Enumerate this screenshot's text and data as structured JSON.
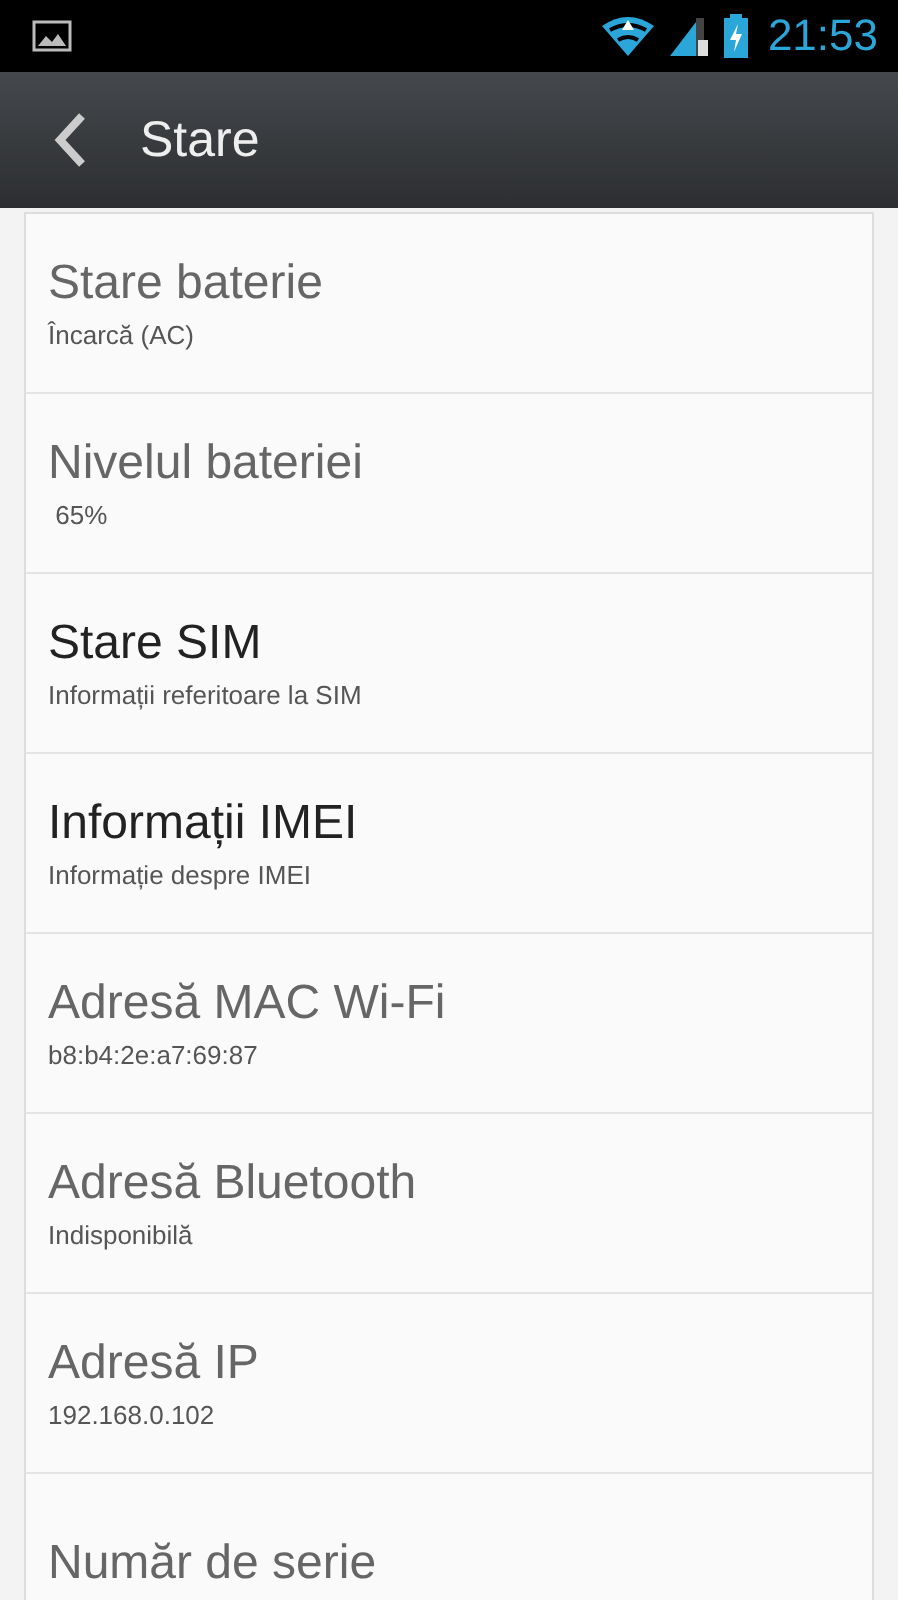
{
  "status_bar": {
    "time": "21:53"
  },
  "action_bar": {
    "title": "Stare"
  },
  "items": [
    {
      "title": "Stare baterie",
      "summary": "Încarcă (AC)",
      "disabled": true
    },
    {
      "title": "Nivelul bateriei",
      "summary": " 65%",
      "disabled": true
    },
    {
      "title": "Stare SIM",
      "summary": "Informații referitoare la SIM",
      "disabled": false
    },
    {
      "title": "Informații IMEI",
      "summary": "Informație despre IMEI",
      "disabled": false
    },
    {
      "title": "Adresă MAC Wi-Fi",
      "summary": "b8:b4:2e:a7:69:87",
      "disabled": true
    },
    {
      "title": "Adresă Bluetooth",
      "summary": "Indisponibilă",
      "disabled": true
    },
    {
      "title": "Adresă IP",
      "summary": "192.168.0.102",
      "disabled": true
    },
    {
      "title": "Număr de serie",
      "disabled": true
    }
  ]
}
